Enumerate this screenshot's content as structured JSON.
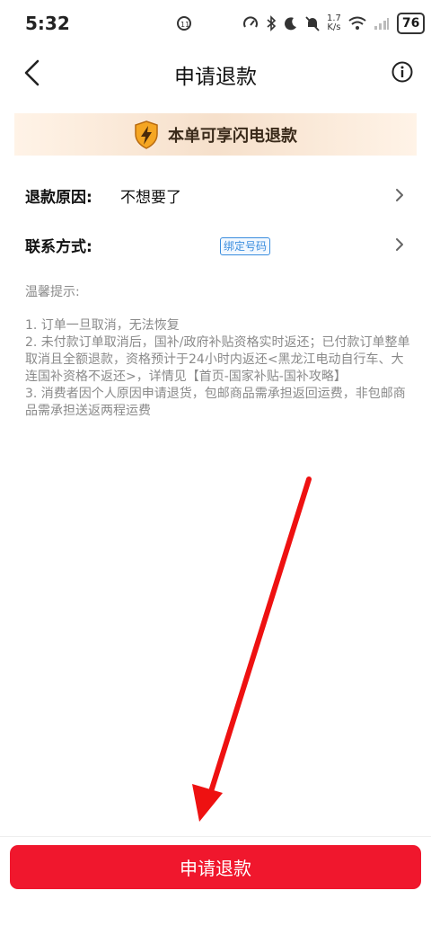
{
  "status_bar": {
    "time": "5:32",
    "net_speed_value": "1.7",
    "net_speed_unit": "K/s",
    "battery": "76",
    "icons": [
      "weather-icon",
      "speedometer-icon",
      "bluetooth-icon",
      "moon-icon",
      "mute-icon",
      "wifi-icon",
      "signal-icon",
      "battery-icon"
    ]
  },
  "nav": {
    "title": "申请退款",
    "back_icon": "chevron-left-icon",
    "info_icon": "info-icon"
  },
  "banner": {
    "text": "本单可享闪电退款",
    "icon": "lightning-shield-icon"
  },
  "form": {
    "reason_label": "退款原因:",
    "reason_value": "不想要了",
    "contact_label": "联系方式:",
    "contact_badge": "绑定号码"
  },
  "tips": {
    "title": "温馨提示:",
    "items": [
      "1. 订单一旦取消，无法恢复",
      "2. 未付款订单取消后，国补/政府补贴资格实时返还；已付款订单整单取消且全额退款，资格预计于24小时内返还<黑龙江电动自行车、大连国补资格不返还>，详情见【首页-国家补贴-国补攻略】",
      "3. 消费者因个人原因申请退货，包邮商品需承担返回运费，非包邮商品需承担送返两程运费"
    ]
  },
  "submit_label": "申请退款",
  "colors": {
    "primary": "#f0172d",
    "banner_bg": "#f6e0cb",
    "badge": "#3a8dde",
    "tip_text": "#8a8a8a"
  }
}
